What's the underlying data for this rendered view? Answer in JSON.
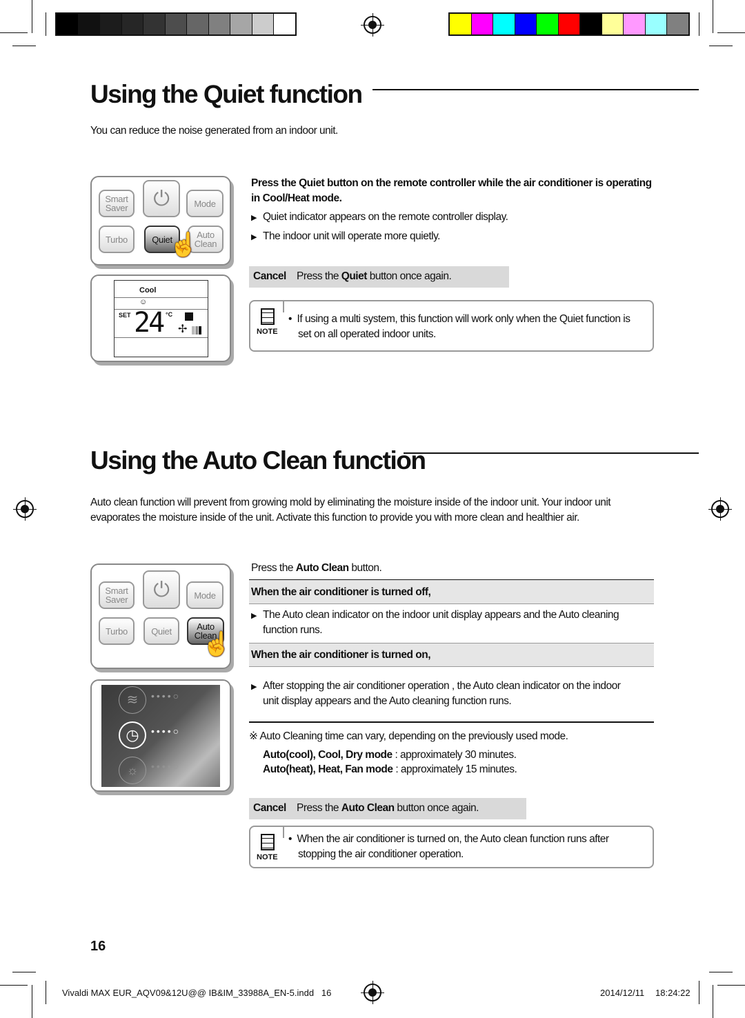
{
  "print_marks": {
    "gray_swatches": [
      "#000000",
      "#111111",
      "#1c1c1c",
      "#262626",
      "#333333",
      "#4d4d4d",
      "#666666",
      "#808080",
      "#a6a6a6",
      "#cccccc",
      "#ffffff"
    ],
    "color_swatches": [
      "#ffff00",
      "#ff00ff",
      "#00ffff",
      "#0000ff",
      "#00ff00",
      "#ff0000",
      "#000000",
      "#ffff99",
      "#ff99ff",
      "#99ffff",
      "#808080"
    ]
  },
  "quiet": {
    "title": "Using the Quiet function",
    "intro": "You can reduce the noise generated from an indoor unit.",
    "remote": {
      "smart_saver": "Smart Saver",
      "mode": "Mode",
      "turbo": "Turbo",
      "quiet": "Quiet",
      "auto_clean": "Auto Clean"
    },
    "display": {
      "mode": "Cool",
      "set": "SET",
      "temp": "24",
      "unit": "°C"
    },
    "instr_pre": "Press the ",
    "instr_bold": "Quiet",
    "instr_post": " button on the remote controller while the air conditioner is operating",
    "instr_line2": "in Cool/Heat mode.",
    "bullets": [
      "Quiet indicator appears on the remote controller display.",
      "The indoor unit will operate more quietly."
    ],
    "cancel": {
      "label": "Cancel",
      "pre": "Press the ",
      "bold": "Quiet",
      "post": " button once again."
    },
    "note": {
      "label": "NOTE",
      "line1": "If using a multi system, this function will work only when the Quiet function is",
      "line2": "set on all operated indoor units."
    }
  },
  "autoclean": {
    "title": "Using the Auto Clean function",
    "intro1": "Auto clean function will prevent from growing mold by eliminating the moisture inside of the indoor unit. Your indoor unit",
    "intro2": "evaporates the moisture inside of the unit. Activate this function to provide you with more clean and healthier air.",
    "remote": {
      "smart_saver": "Smart Saver",
      "mode": "Mode",
      "turbo": "Turbo",
      "quiet": "Quiet",
      "auto_clean": "Auto Clean"
    },
    "instr_pre": "Press the ",
    "instr_bold": "Auto Clean",
    "instr_post": " button.",
    "off_header": "When the air conditioner is turned off,",
    "off_line1": "The Auto clean indicator on the indoor unit display appears and the Auto cleaning",
    "off_line2": "function runs.",
    "on_header": "When the air conditioner is turned on,",
    "on_line1": "After stopping the air conditioner operation , the Auto clean indicator on the indoor",
    "on_line2": "unit display appears and the Auto cleaning function runs.",
    "time_note": "Auto Cleaning time can vary, depending on the previously used mode.",
    "time1_bold": "Auto(cool), Cool, Dry mode",
    "time1": " : approximately 30 minutes.",
    "time2_bold": "Auto(heat), Heat, Fan mode",
    "time2": " : approximately 15 minutes.",
    "cancel": {
      "label": "Cancel",
      "pre": "Press the ",
      "bold": "Auto Clean",
      "post": " button once again."
    },
    "note": {
      "label": "NOTE",
      "line1": "When the air conditioner is turned on, the Auto clean function runs after",
      "line2": "stopping the air conditioner operation."
    }
  },
  "page_number": "16",
  "footer": {
    "file": "Vivaldi MAX EUR_AQV09&12U@@ IB&IM_33988A_EN-5.indd   16",
    "date": "2014/12/11",
    "time": "18:24:22"
  }
}
